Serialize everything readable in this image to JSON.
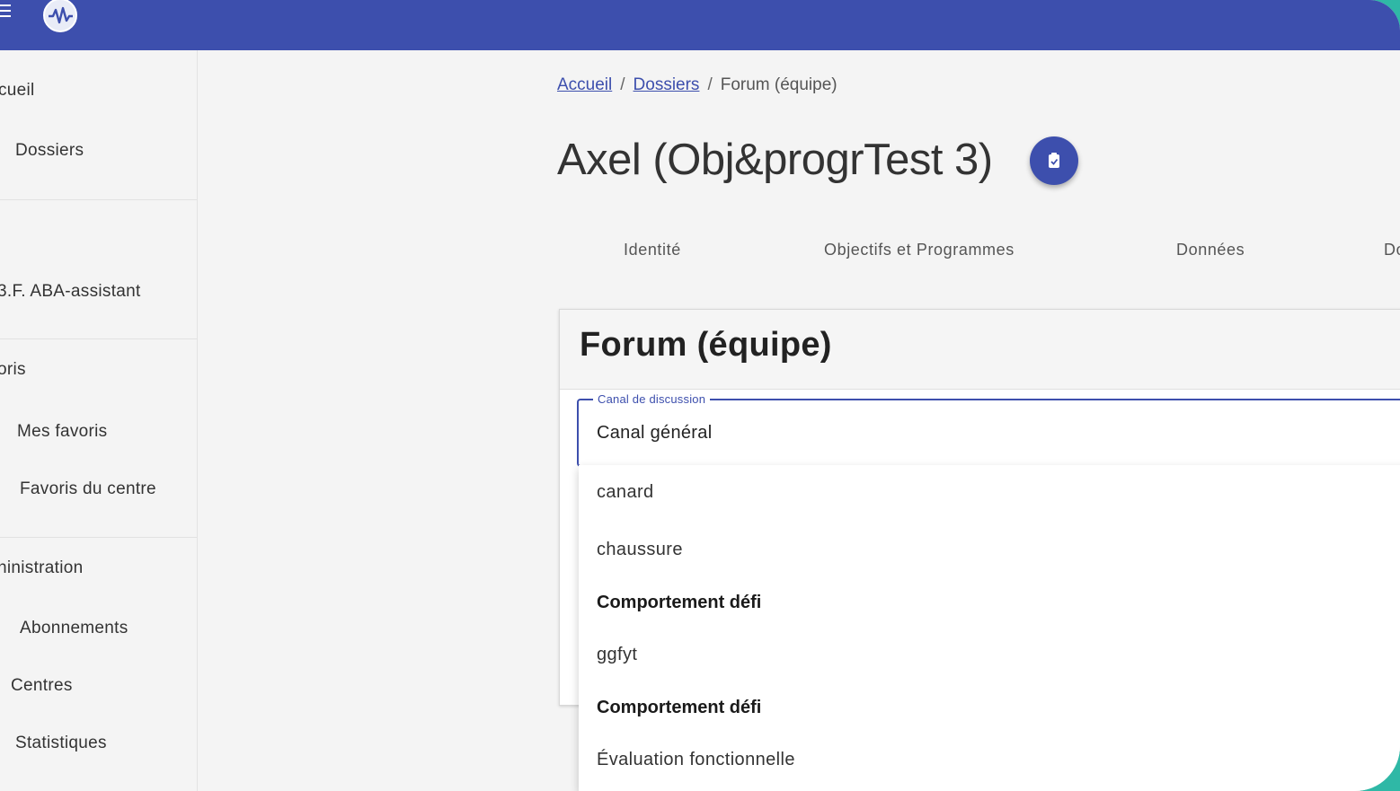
{
  "header": {
    "menu_icon": "hamburger-menu-icon",
    "logo_icon": "brain-wave-logo-icon",
    "bar_color": "#3d4fad"
  },
  "sidebar": {
    "items": [
      {
        "label": "cueil"
      },
      {
        "label": "Dossiers"
      },
      {
        "label": "3.F. ABA-assistant"
      },
      {
        "label": "oris"
      },
      {
        "label": "Mes favoris"
      },
      {
        "label": "Favoris du centre"
      },
      {
        "label": "ninistration"
      },
      {
        "label": "Abonnements"
      },
      {
        "label": "Centres"
      },
      {
        "label": "Statistiques"
      }
    ]
  },
  "breadcrumb": {
    "items": [
      "Accueil",
      "Dossiers"
    ],
    "separator": "/",
    "current": "Forum (équipe)"
  },
  "page": {
    "title": "Axel (Obj&progrTest 3)",
    "title_button_icon": "clipboard-check-icon"
  },
  "tabs": [
    {
      "label": "Identité"
    },
    {
      "label": "Objectifs et Programmes"
    },
    {
      "label": "Données"
    },
    {
      "label": "Do"
    }
  ],
  "forum": {
    "title": "Forum (équipe)",
    "channel_label": "Canal de discussion",
    "channel_value": "Canal général",
    "options": [
      {
        "label": "canard",
        "bold": false
      },
      {
        "label": "chaussure",
        "bold": false
      },
      {
        "label": "Comportement défi",
        "bold": true
      },
      {
        "label": "ggfyt",
        "bold": false
      },
      {
        "label": "Comportement défi",
        "bold": true
      },
      {
        "label": "Évaluation fonctionnelle",
        "bold": false
      }
    ]
  },
  "colors": {
    "accent": "#3d4fad",
    "frame": "#2fb8a6",
    "background": "#f4f4f4"
  }
}
